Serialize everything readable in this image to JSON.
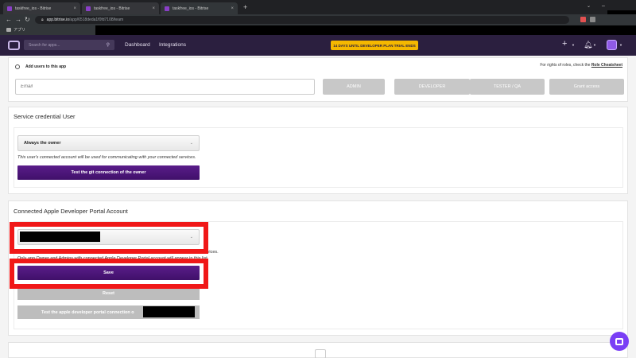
{
  "browser": {
    "tabs": [
      {
        "title": "taskfree_ios - Bitrise"
      },
      {
        "title": "taskfree_ios - Bitrise"
      },
      {
        "title": "taskfree_ios - Bitrise"
      }
    ],
    "url_host": "app.bitrise.io",
    "url_path": "/app/6518deda1f0fd7108/team",
    "bookmark": "アプリ"
  },
  "header": {
    "search_placeholder": "Search for apps...",
    "nav": [
      "Dashboard",
      "Integrations"
    ],
    "trial_banner": "14 DAYS UNTIL DEVELOPER PLAN TRIAL ENDS",
    "plus_icon": "+",
    "bell_icon": "bell-icon"
  },
  "team": {
    "add_users_label": "Add users to this app",
    "rights_text": "For rights of roles, check the",
    "rights_link": "Role Cheatsheet",
    "email_placeholder": "Email",
    "roles": [
      "ADMIN",
      "DEVELOPER",
      "TESTER / QA",
      "Grant access"
    ]
  },
  "service_credential": {
    "title": "Service credential User",
    "selected": "Always the owner",
    "hint": "This user's connected account will be used for communicating with your connected services.",
    "test_button": "Test the git connection of the owner"
  },
  "apple_portal": {
    "title": "Connected Apple Developer Portal Account",
    "hint_line1_end": "services.",
    "hint_line2": "Only app Owner and Admins with connected Apple Developer Portal account will appear in this list.",
    "save_button": "Save",
    "reset_button": "Reset",
    "test_button": "Test the apple developer portal connection o"
  },
  "colors": {
    "primary": "#4b1679",
    "highlight": "#f01818",
    "header_bg": "#2b1f3f",
    "trial_bg": "#f5b800"
  }
}
